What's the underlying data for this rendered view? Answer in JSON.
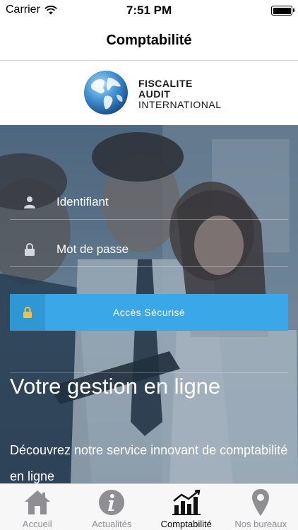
{
  "status_bar": {
    "carrier": "Carrier",
    "time": "7:51 PM"
  },
  "nav": {
    "title": "Comptabilité"
  },
  "logo": {
    "line1": "FISCALITE",
    "line2": "AUDIT",
    "line3": "INTERNATIONAL"
  },
  "login": {
    "username_label": "Identifiant",
    "password_label": "Mot de passe",
    "secure_button": "Accès Sécurisé"
  },
  "hero": {
    "title": "Votre gestion en ligne",
    "subtitle": "Découvrez notre service innovant de comptabilité en ligne"
  },
  "tabs": [
    {
      "label": "Accueil",
      "icon": "home-icon",
      "active": false
    },
    {
      "label": "Actualités",
      "icon": "info-icon",
      "active": false
    },
    {
      "label": "Comptabilité",
      "icon": "chart-icon",
      "active": true
    },
    {
      "label": "Nos bureaux",
      "icon": "map-pin-icon",
      "active": false
    }
  ],
  "colors": {
    "accent": "#3aa8e8",
    "accent_dark": "#2f97d4",
    "tab_inactive": "#8e8e93"
  }
}
